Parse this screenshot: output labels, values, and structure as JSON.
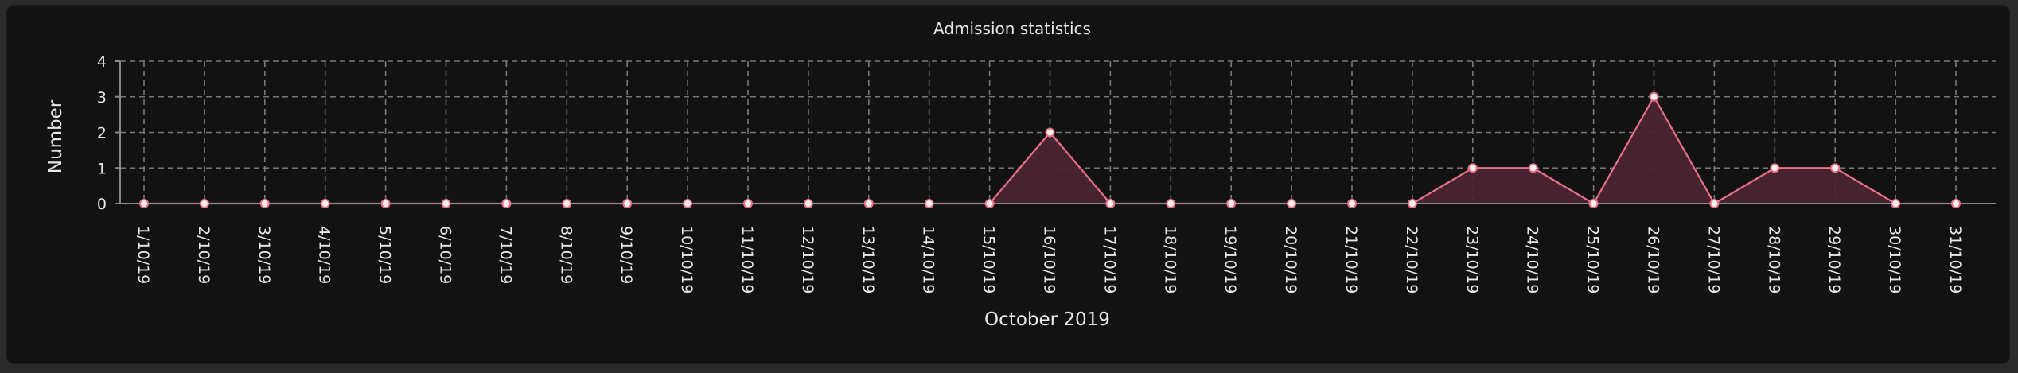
{
  "chart_data": {
    "type": "area",
    "title": "Admission statistics",
    "xlabel": "October 2019",
    "ylabel": "Number",
    "ylim": [
      0,
      4
    ],
    "yticks": [
      0,
      1,
      2,
      3,
      4
    ],
    "grid": true,
    "categories": [
      "1/10/19",
      "2/10/19",
      "3/10/19",
      "4/10/19",
      "5/10/19",
      "6/10/19",
      "7/10/19",
      "8/10/19",
      "9/10/19",
      "10/10/19",
      "11/10/19",
      "12/10/19",
      "13/10/19",
      "14/10/19",
      "15/10/19",
      "16/10/19",
      "17/10/19",
      "18/10/19",
      "19/10/19",
      "20/10/19",
      "21/10/19",
      "22/10/19",
      "23/10/19",
      "24/10/19",
      "25/10/19",
      "26/10/19",
      "27/10/19",
      "28/10/19",
      "29/10/19",
      "30/10/19",
      "31/10/19"
    ],
    "series": [
      {
        "values": [
          0,
          0,
          0,
          0,
          0,
          0,
          0,
          0,
          0,
          0,
          0,
          0,
          0,
          0,
          0,
          2,
          0,
          0,
          0,
          0,
          0,
          0,
          1,
          1,
          0,
          3,
          0,
          1,
          1,
          0,
          0
        ]
      }
    ],
    "colors": {
      "line": "#e8708a",
      "fill": "#4a2530",
      "marker_fill": "#f5f0e8",
      "marker_stroke": "#e8708a",
      "grid": "#777777",
      "text": "#e8e8e8",
      "background": "#121212"
    }
  }
}
